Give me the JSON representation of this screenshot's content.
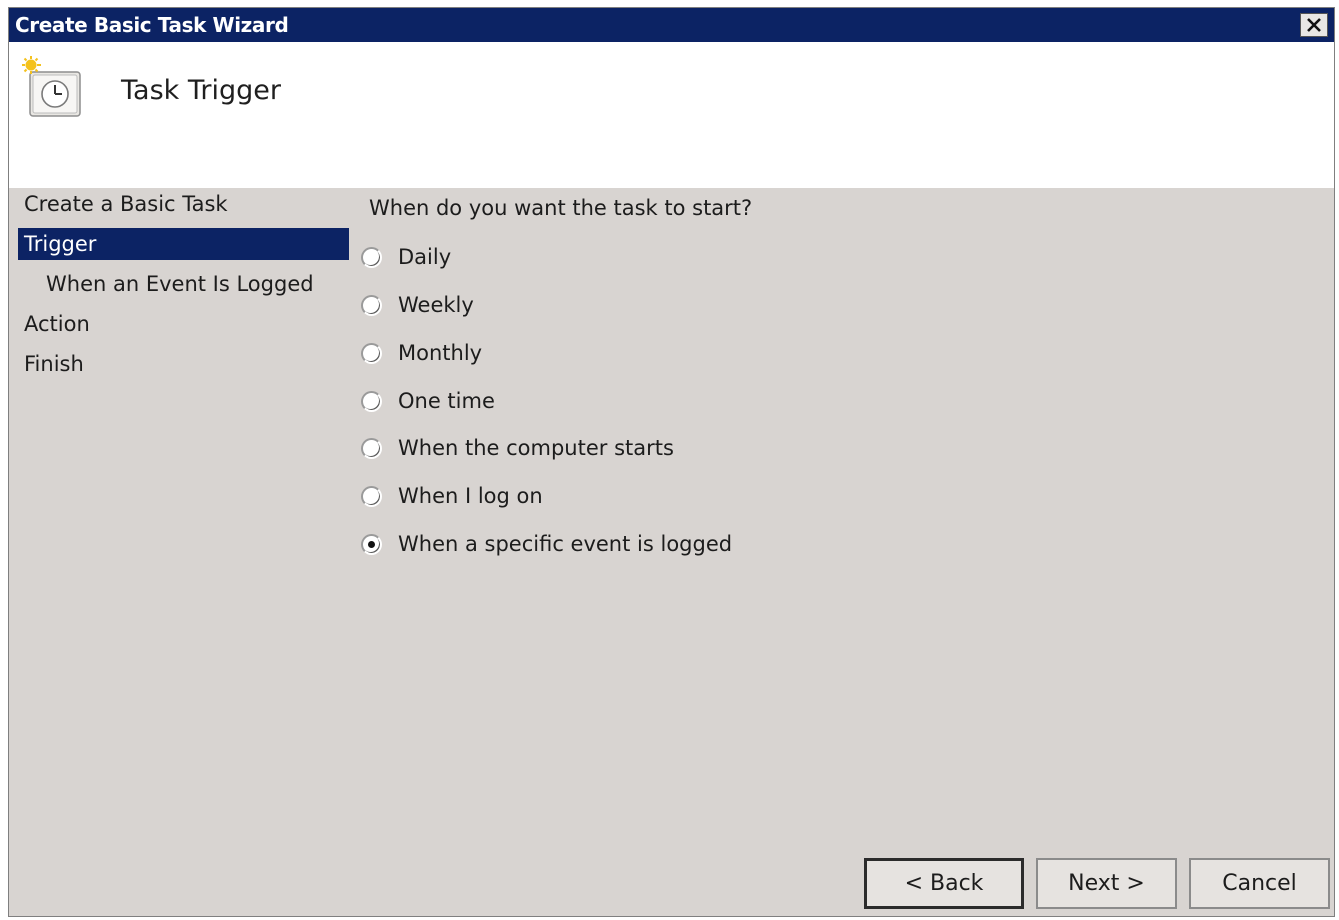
{
  "window": {
    "title": "Create Basic Task Wizard"
  },
  "header": {
    "title": "Task Trigger",
    "icon": "task-clock-icon"
  },
  "sidebar": {
    "items": [
      {
        "label": "Create a Basic Task",
        "selected": false
      },
      {
        "label": "Trigger",
        "selected": true
      },
      {
        "label": "When an Event Is Logged",
        "selected": false
      },
      {
        "label": "Action",
        "selected": false
      },
      {
        "label": "Finish",
        "selected": false
      }
    ]
  },
  "main": {
    "prompt": "When do you want the task to start?",
    "options": [
      {
        "label": "Daily",
        "checked": false
      },
      {
        "label": "Weekly",
        "checked": false
      },
      {
        "label": "Monthly",
        "checked": false
      },
      {
        "label": "One time",
        "checked": false
      },
      {
        "label": "When the computer starts",
        "checked": false
      },
      {
        "label": "When I log on",
        "checked": false
      },
      {
        "label": "When a specific event is logged",
        "checked": true
      }
    ]
  },
  "buttons": {
    "back": "< Back",
    "next": "Next >",
    "cancel": "Cancel"
  },
  "colors": {
    "titlebar": "#0c2364",
    "dialog_bg": "#d8d4d1",
    "selection": "#0c2364"
  }
}
